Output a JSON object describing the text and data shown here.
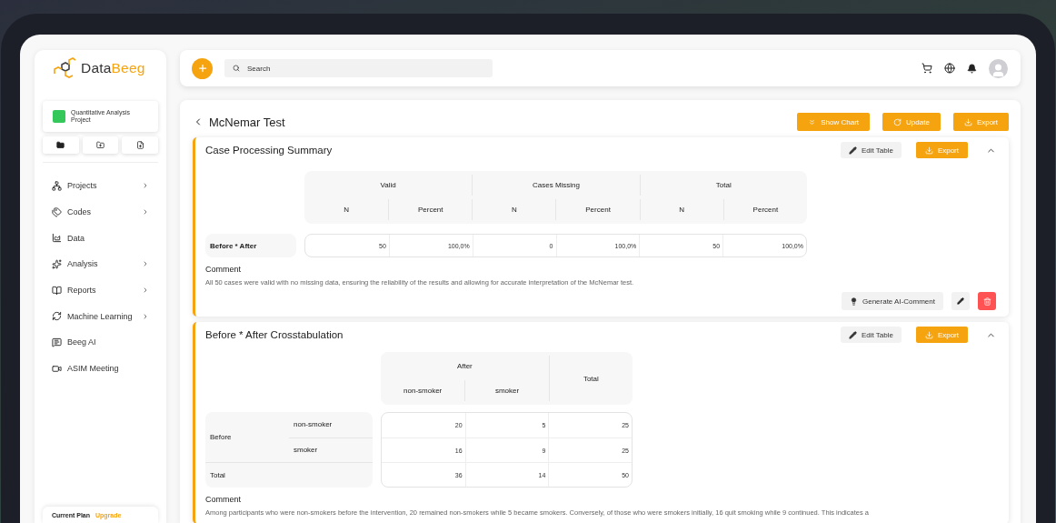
{
  "brand": {
    "first": "Data",
    "second": "Beeg"
  },
  "project": {
    "name": "Quantitative Analysis Project",
    "color": "#34c759"
  },
  "sidebar": {
    "items": [
      {
        "label": "Projects",
        "has_submenu": true
      },
      {
        "label": "Codes",
        "has_submenu": true
      },
      {
        "label": "Data",
        "has_submenu": false
      },
      {
        "label": "Analysis",
        "has_submenu": true
      },
      {
        "label": "Reports",
        "has_submenu": true
      },
      {
        "label": "Machine Learning",
        "has_submenu": true
      },
      {
        "label": "Beeg AI",
        "has_submenu": false
      },
      {
        "label": "ASIM Meeting",
        "has_submenu": false
      }
    ]
  },
  "plan": {
    "label": "Current Plan",
    "link": "Upgrade"
  },
  "topbar": {
    "search": {
      "placeholder": "Search"
    }
  },
  "page": {
    "title": "McNemar Test",
    "actions": [
      "Show Chart",
      "Update",
      "Export"
    ]
  },
  "sections": [
    {
      "kind": "summary",
      "title": "Case Processing Summary",
      "edit": "Edit Table",
      "export": "Export",
      "expanded": true,
      "groups": [
        "Valid",
        "Cases Missing",
        "Total"
      ],
      "subheaders": [
        "N",
        "Percent",
        "N",
        "Percent",
        "N",
        "Percent"
      ],
      "rows": [
        {
          "label": "Before * After",
          "cells": [
            "50",
            "100,0%",
            "0",
            "100,0%",
            "50",
            "100,0%"
          ]
        }
      ],
      "comment_label": "Comment",
      "comment": "All 50 cases were valid with no missing data, ensuring the reliability of the results and allowing for accurate interpretation of the McNemar test.",
      "ai_button": "Generate AI-Comment"
    },
    {
      "kind": "crosstab",
      "title": "Before * After Crosstabulation",
      "edit": "Edit Table",
      "export": "Export",
      "expanded": true,
      "column_group": "After",
      "columns": [
        "non-smoker",
        "smoker"
      ],
      "total_column": "Total",
      "row_group": "Before",
      "rows": [
        {
          "label": "non-smoker",
          "cells": [
            "20",
            "5",
            "25"
          ]
        },
        {
          "label": "smoker",
          "cells": [
            "16",
            "9",
            "25"
          ]
        }
      ],
      "total_row": {
        "label": "Total",
        "cells": [
          "36",
          "14",
          "50"
        ]
      },
      "comment_label": "Comment",
      "comment": "Among participants who were non-smokers before the intervention, 20 remained non-smokers while 5 became smokers. Conversely, of those who were smokers initially, 16 quit smoking while 9 continued. This indicates a"
    }
  ]
}
